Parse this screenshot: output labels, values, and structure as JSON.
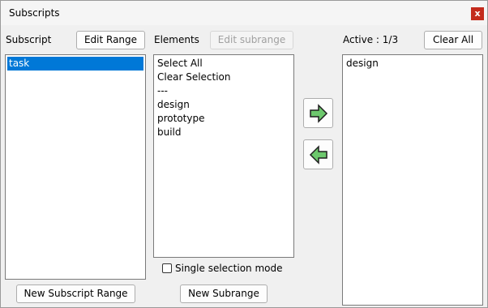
{
  "window": {
    "title": "Subscripts",
    "close_glyph": "x"
  },
  "subscript": {
    "label": "Subscript",
    "edit_range_label": "Edit Range",
    "items": [
      {
        "label": "task",
        "selected": true
      }
    ],
    "new_range_label": "New Subscript Range"
  },
  "elements": {
    "label": "Elements",
    "edit_subrange_label": "Edit subrange",
    "items": [
      "Select All",
      "Clear Selection",
      "---",
      "design",
      "prototype",
      "build"
    ],
    "single_selection_label": "Single selection mode",
    "single_selection_checked": false,
    "new_subrange_label": "New Subrange"
  },
  "active": {
    "label": "Active : 1/3",
    "clear_all_label": "Clear All",
    "items": [
      "design"
    ]
  },
  "colors": {
    "selection": "#0078d7",
    "arrow": "#6dc86d",
    "close": "#c42b1c"
  },
  "icons": {
    "add": "arrow-right-icon",
    "remove": "arrow-left-icon"
  }
}
